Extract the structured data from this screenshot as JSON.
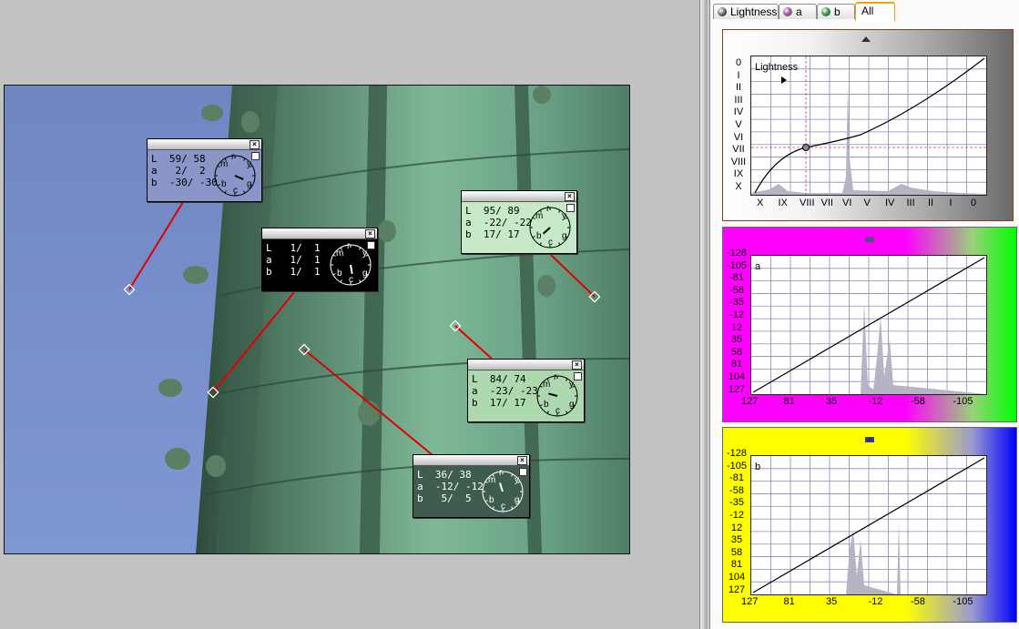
{
  "tabs": [
    {
      "label": "Lightness",
      "icon": "lightness-ball-icon",
      "color": "#3a3a3a"
    },
    {
      "label": "a",
      "icon": "a-ball-icon",
      "color": "#b048b0"
    },
    {
      "label": "b",
      "icon": "b-ball-icon",
      "color": "#4a9a3a"
    },
    {
      "label": "All",
      "icon": "",
      "color": ""
    }
  ],
  "samples": [
    {
      "id": "s1",
      "L": "59/ 58",
      "a": " 2/  2",
      "b": "-30/ -30",
      "bg": "#8a95c8",
      "fg": "#000000"
    },
    {
      "id": "s2",
      "L": " 1/  1",
      "a": " 1/  1",
      "b": " 1/  1",
      "bg": "#000000",
      "fg": "#ffffff"
    },
    {
      "id": "s3",
      "L": "95/ 89",
      "a": "-22/ -22",
      "b": "17/ 17",
      "bg": "#c6eac8",
      "fg": "#000000"
    },
    {
      "id": "s4",
      "L": "84/ 74",
      "a": "-23/ -23",
      "b": "17/ 17",
      "bg": "#aed8ae",
      "fg": "#000000"
    },
    {
      "id": "s5",
      "L": "36/ 38",
      "a": "-12/ -12",
      "b": " 5/  5",
      "bg": "#3f5d4e",
      "fg": "#ffffff"
    }
  ],
  "dial_letters": [
    "m",
    "r",
    "y",
    "b",
    "c",
    "g"
  ],
  "row_keys": [
    "L",
    "a",
    "b"
  ],
  "lightness_graph": {
    "title": "Lightness",
    "zones_left": [
      "0",
      "I",
      "II",
      "III",
      "IV",
      "V",
      "VI",
      "VII",
      "VIII",
      "IX",
      "X"
    ],
    "zones_bottom": [
      "X",
      "IX",
      "VIII",
      "VII",
      "VI",
      "V",
      "IV",
      "III",
      "II",
      "I",
      "0"
    ]
  },
  "a_graph": {
    "title": "a",
    "left_ticks": [
      "-128",
      "-105",
      "-81",
      "-58",
      "-35",
      "-12",
      "12",
      "35",
      "58",
      "81",
      "104",
      "127"
    ],
    "bottom_ticks": [
      "127",
      "81",
      "35",
      "-12",
      "-58",
      "-105"
    ],
    "gradient": [
      "#ff00ff",
      "#00ff00"
    ]
  },
  "b_graph": {
    "title": "b",
    "left_ticks": [
      "-128",
      "-105",
      "-81",
      "-58",
      "-35",
      "-12",
      "12",
      "35",
      "58",
      "81",
      "104",
      "127"
    ],
    "bottom_ticks": [
      "127",
      "81",
      "35",
      "-12",
      "-58",
      "-105"
    ],
    "gradient": [
      "#ffff00",
      "#0000ff"
    ]
  }
}
